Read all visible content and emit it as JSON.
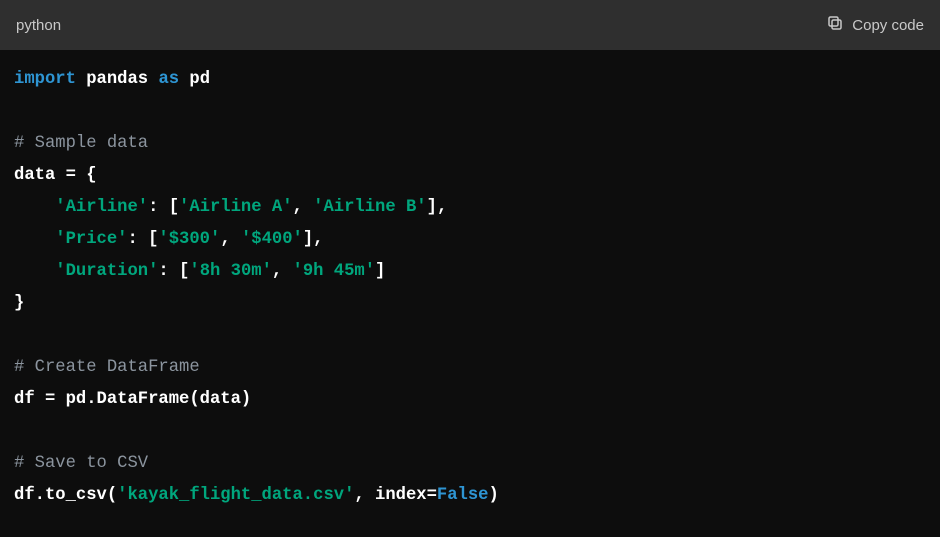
{
  "header": {
    "language": "python",
    "copy_label": "Copy code"
  },
  "code": {
    "line1": {
      "kw": "import",
      "mod": "pandas",
      "as": "as",
      "alias": "pd"
    },
    "line3_comment": "# Sample data",
    "line4_a": "data = {",
    "line5_key": "'Airline'",
    "line5_sep": ": [",
    "line5_v1": "'Airline A'",
    "line5_c": ", ",
    "line5_v2": "'Airline B'",
    "line5_end": "],",
    "line6_key": "'Price'",
    "line6_sep": ": [",
    "line6_v1": "'$300'",
    "line6_c": ", ",
    "line6_v2": "'$400'",
    "line6_end": "],",
    "line7_key": "'Duration'",
    "line7_sep": ": [",
    "line7_v1": "'8h 30m'",
    "line7_c": ", ",
    "line7_v2": "'9h 45m'",
    "line7_end": "]",
    "line8": "}",
    "line10_comment": "# Create DataFrame",
    "line11": "df = pd.DataFrame(data)",
    "line13_comment": "# Save to CSV",
    "line14_a": "df.to_csv(",
    "line14_str": "'kayak_flight_data.csv'",
    "line14_b": ", index=",
    "line14_bool": "False",
    "line14_c": ")"
  }
}
